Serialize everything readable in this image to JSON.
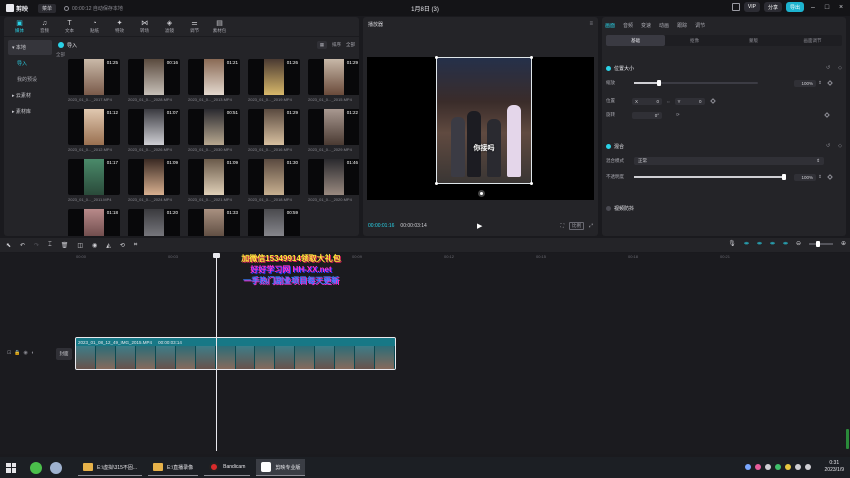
{
  "titlebar": {
    "app_name": "剪映",
    "menu_label": "菜单",
    "autosave": "00:00:12 自动保存本地",
    "project_title": "1月8日 (3)",
    "vip_label": "VIP",
    "share_label": "分享",
    "export_label": "导出"
  },
  "toolbar": [
    {
      "label": "媒体",
      "icon": "▣",
      "active": true
    },
    {
      "label": "音频",
      "icon": "♫",
      "active": false
    },
    {
      "label": "文本",
      "icon": "T",
      "active": false
    },
    {
      "label": "贴纸",
      "icon": "◔",
      "active": false
    },
    {
      "label": "特效",
      "icon": "✦",
      "active": false
    },
    {
      "label": "转场",
      "icon": "⋈",
      "active": false
    },
    {
      "label": "滤镜",
      "icon": "◈",
      "active": false
    },
    {
      "label": "调节",
      "icon": "⚌",
      "active": false
    },
    {
      "label": "素材包",
      "icon": "▤",
      "active": false
    }
  ],
  "sidebar": {
    "items": [
      {
        "label": "▾ 本地",
        "active": true,
        "sub": false
      },
      {
        "label": "导入",
        "active": true,
        "sub": true
      },
      {
        "label": "我的预设",
        "active": false,
        "sub": true
      },
      {
        "label": "▸ 云素材",
        "active": false,
        "sub": false
      },
      {
        "label": "▸ 素材库",
        "active": false,
        "sub": false
      }
    ]
  },
  "media": {
    "import_label": "导入",
    "sort_label": "排序",
    "filter_label": "全部",
    "view_label": "▦",
    "section_label": "全部",
    "clips": [
      {
        "duration": "01:25",
        "name": "2023_01_0..._2017.MP4"
      },
      {
        "duration": "00:16",
        "name": "2023_01_0..._2028.MP4"
      },
      {
        "duration": "01:21",
        "name": "2023_01_0..._2013.MP4"
      },
      {
        "duration": "01:26",
        "name": "2023_01_0..._2019.MP4"
      },
      {
        "duration": "01:29",
        "name": "2023_01_0..._2015.MP4"
      },
      {
        "duration": "01:12",
        "name": "2023_01_0..._2012.MP4"
      },
      {
        "duration": "01:07",
        "name": "2023_01_0..._2026.MP4"
      },
      {
        "duration": "00:51",
        "name": "2023_01_0..._2030.MP4"
      },
      {
        "duration": "01:29",
        "name": "2023_01_0..._2016.MP4"
      },
      {
        "duration": "01:22",
        "name": "2023_01_0..._2029.MP4"
      },
      {
        "duration": "01:17",
        "name": "2023_01_0..._2011.MP4"
      },
      {
        "duration": "01:09",
        "name": "2023_01_0..._2024.MP4"
      },
      {
        "duration": "01:09",
        "name": "2023_01_0..._2021.MP4"
      },
      {
        "duration": "01:30",
        "name": "2023_01_0..._2018.MP4"
      },
      {
        "duration": "01:46",
        "name": "2023_01_0..._2020.MP4"
      },
      {
        "duration": "01:18",
        "name": ""
      },
      {
        "duration": "01:20",
        "name": ""
      },
      {
        "duration": "01:33",
        "name": ""
      },
      {
        "duration": "00:59",
        "name": ""
      }
    ]
  },
  "player": {
    "title": "播放器",
    "current_time": "00:00:01:16",
    "total_time": "00:00:03:14",
    "caption": "你接吗",
    "ratio_label": "比例"
  },
  "properties": {
    "tabs": [
      "画面",
      "音频",
      "变速",
      "动画",
      "跟踪",
      "调节"
    ],
    "subtabs": [
      "基础",
      "抠像",
      "蒙版",
      "画面调节"
    ],
    "position_section": "位置大小",
    "scale_label": "缩放",
    "scale_value": "100%",
    "scale_fraction": 0.2,
    "position_label": "位置",
    "pos_x_label": "X",
    "pos_x": "0",
    "pos_y_label": "Y",
    "pos_y": "0",
    "rotate_label": "旋转",
    "rotate_value": "0°",
    "blend_section": "混合",
    "blend_mode_label": "混合模式",
    "blend_mode_value": "正常",
    "opacity_label": "不透明度",
    "opacity_value": "100%",
    "opacity_fraction": 1.0,
    "stabilize_section": "视频防抖"
  },
  "timeline": {
    "ruler": [
      "00:00",
      "00:03",
      "00:06",
      "00:09",
      "00:12",
      "00:15",
      "00:18",
      "00:21"
    ],
    "watermark_line1": "加微信15349914领取大礼包",
    "watermark_line2": "好好学习网 HH-XX.net",
    "watermark_line3": "一手热门副业项目每天更新",
    "cover_label": "封面",
    "clip_name": "2023_01_08_12_49_IMG_2015.MP4",
    "clip_duration": "00:00:03:14"
  },
  "taskbar": {
    "tasks": [
      {
        "label": "E:\\虚拟\\315不固...",
        "icon": "folder",
        "active": false
      },
      {
        "label": "E:\\直播录像",
        "icon": "folder",
        "active": false
      },
      {
        "label": "Bandicam",
        "icon": "rec",
        "active": false
      },
      {
        "label": "剪映专业版",
        "icon": "capcut",
        "active": true
      }
    ],
    "time": "0:31",
    "date": "2023/1/9"
  }
}
